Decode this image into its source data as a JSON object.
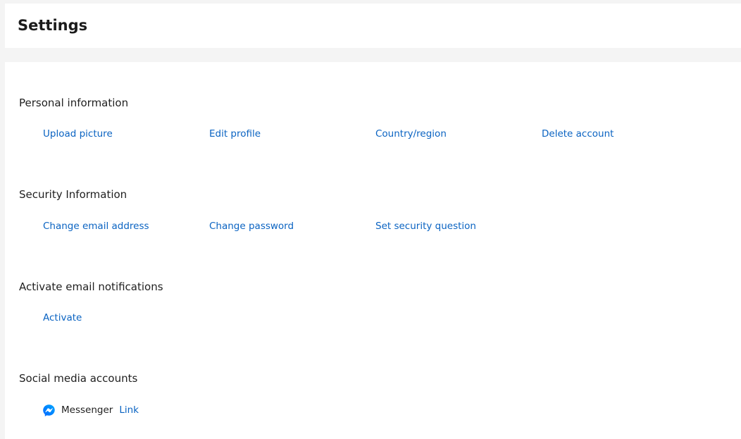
{
  "header": {
    "title": "Settings"
  },
  "sections": {
    "personal": {
      "title": "Personal information",
      "links": [
        "Upload picture",
        "Edit profile",
        "Country/region",
        "Delete account"
      ]
    },
    "security": {
      "title": "Security Information",
      "links": [
        "Change email address",
        "Change password",
        "Set security question"
      ]
    },
    "notifications": {
      "title": "Activate email notifications",
      "links": [
        "Activate"
      ]
    },
    "social": {
      "title": "Social media accounts",
      "accounts": [
        {
          "name": "Messenger",
          "icon": "messenger-icon",
          "action": "Link"
        }
      ]
    }
  },
  "colors": {
    "link": "#0a63c2",
    "messenger": "#1877f2"
  }
}
